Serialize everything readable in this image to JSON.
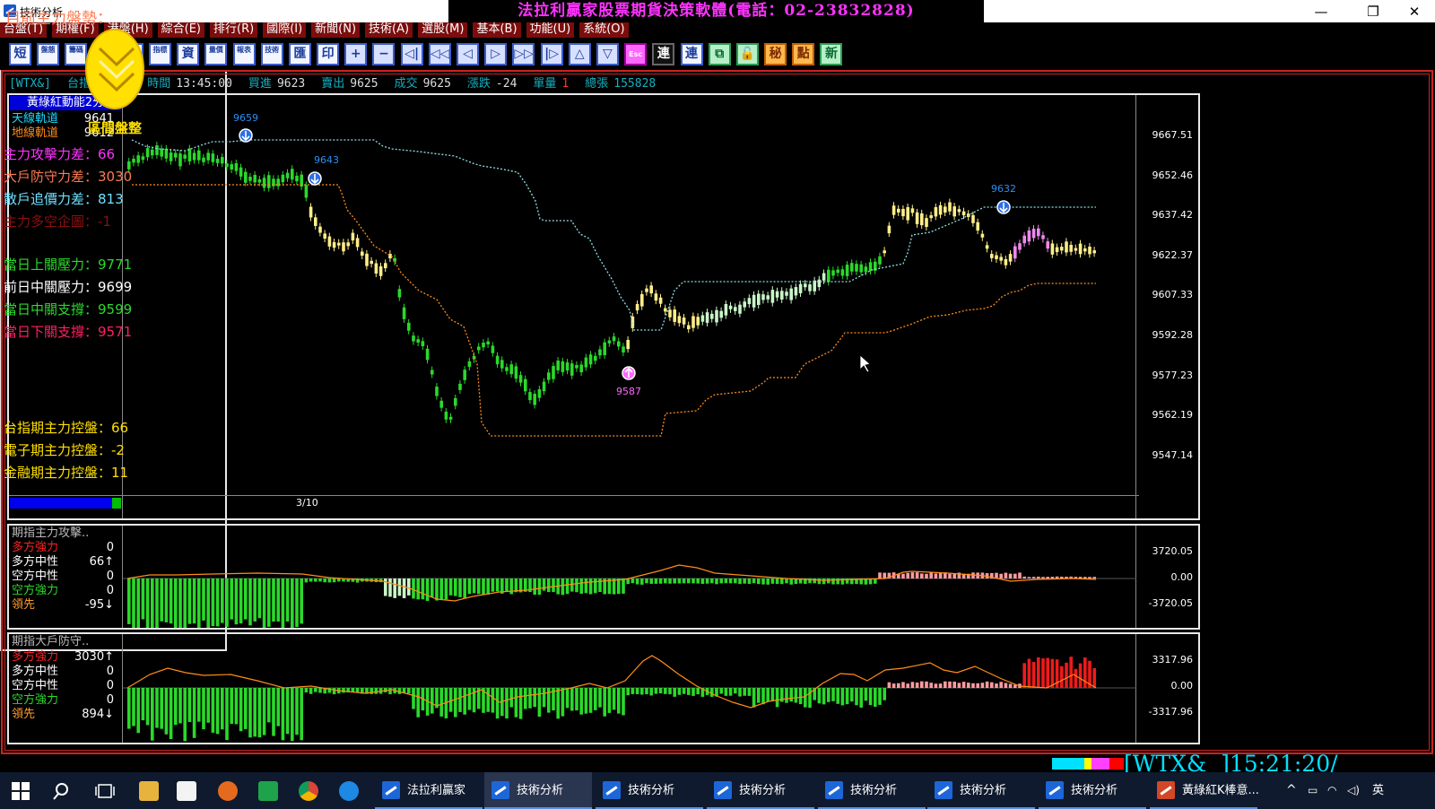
{
  "window": {
    "title": "技術分析",
    "banner": "法拉利贏家股票期貨決策軟體(電話：02-23832828)",
    "controls": [
      "—",
      "❐",
      "✕"
    ]
  },
  "menu": [
    "台盤(T)",
    "期權(F)",
    "港盤(H)",
    "綜合(E)",
    "排行(R)",
    "國際(I)",
    "新聞(N)",
    "技術(A)",
    "選股(M)",
    "基本(B)",
    "功能(U)",
    "系統(O)"
  ],
  "toolbar": [
    "短",
    "盤態",
    "籌碼",
    "自",
    "商",
    "指標",
    "資",
    "量價",
    "報表",
    "技術",
    "匯",
    "印",
    "+",
    "−",
    "◁|",
    "◁◁",
    "◁",
    "▷",
    "▷▷",
    "|▷",
    "△",
    "▽",
    "Esc",
    "連",
    "連",
    "⧉",
    "🔓",
    "秘",
    "點",
    "新"
  ],
  "infobar": {
    "symbol": "[WTX&]",
    "name": "台指期&(2分)",
    "time_label": "時間",
    "time": "13:45:00",
    "buy_label": "買進",
    "buy": "9623",
    "sell_label": "賣出",
    "sell": "9625",
    "deal_label": "成交",
    "deal": "9625",
    "chg_label": "漲跌",
    "chg": "-24",
    "vol_label": "單量",
    "vol": "1",
    "total_label": "總張",
    "total": "155828"
  },
  "main": {
    "title": "黃綠紅動能2分",
    "legend": [
      {
        "label": "天線軌道",
        "value": "9641",
        "color": "#19d9ff"
      },
      {
        "label": "地線軌道",
        "value": "9612",
        "color": "#ff8c1a"
      }
    ],
    "yticks": [
      "9667.51",
      "9652.46",
      "9637.42",
      "9622.37",
      "9607.33",
      "9592.28",
      "9577.23",
      "9562.19",
      "9547.14"
    ],
    "date": "3/10",
    "annotations": [
      "9659",
      "9643",
      "9632",
      "9587"
    ]
  },
  "mid": {
    "title": "期指主力攻擊..",
    "rows": [
      {
        "label": "多方強力",
        "value": "0",
        "color": "#ff2020"
      },
      {
        "label": "多方中性",
        "value": "66↑",
        "color": "#ffffff"
      },
      {
        "label": "空方中性",
        "value": "0",
        "color": "#ffffff"
      },
      {
        "label": "空方強力",
        "value": "0",
        "color": "#2ad92a"
      },
      {
        "label": "領先",
        "value": "-95↓",
        "color": "#ff9a2a"
      }
    ],
    "yticks": [
      "3720.05",
      "0.00",
      "-3720.05"
    ]
  },
  "bot": {
    "title": "期指大戶防守..",
    "rows": [
      {
        "label": "多方強力",
        "value": "3030↑",
        "color": "#ff2020"
      },
      {
        "label": "多方中性",
        "value": "0",
        "color": "#ffffff"
      },
      {
        "label": "空方中性",
        "value": "0",
        "color": "#ffffff"
      },
      {
        "label": "空方強力",
        "value": "0",
        "color": "#2ad92a"
      },
      {
        "label": "領先",
        "value": "894↓",
        "color": "#ff9a2a"
      }
    ],
    "yticks": [
      "3317.96",
      "0.00",
      "-3317.96"
    ]
  },
  "right": {
    "title": "目前主力盤勢：",
    "coin_label": "區間盤整",
    "rows": [
      {
        "text": "主力攻擊力差：66",
        "color": "#ff33ff"
      },
      {
        "text": "大戶防守力差：3030",
        "color": "#ff7a50"
      },
      {
        "text": "散戶追價力差：813",
        "color": "#6fe0ff"
      },
      {
        "text": "主力多空企圖：-1",
        "color": "#8a1010"
      },
      {
        "text": "當日上關壓力：9771",
        "color": "#2ad92a"
      },
      {
        "text": "前日中關壓力：9699",
        "color": "#ffffff"
      },
      {
        "text": "當日中關支撐：9599",
        "color": "#2ad92a"
      },
      {
        "text": "當日下關支撐：9571",
        "color": "#ff2060"
      },
      {
        "text": "台指期主力控盤：66",
        "color": "#ffe000"
      },
      {
        "text": "電子期主力控盤：-2",
        "color": "#ffe000"
      },
      {
        "text": "金融期主力控盤：11",
        "color": "#ffe000"
      }
    ]
  },
  "status": {
    "text": "[WTX&  ]15:21:20/"
  },
  "taskbar": {
    "items": [
      "法拉利贏家",
      "技術分析",
      "技術分析",
      "技術分析",
      "技術分析",
      "技術分析",
      "技術分析",
      "黃綠紅K棒意..."
    ],
    "ime": "英"
  },
  "chart_data": {
    "type": "candlestick",
    "ylim": [
      9547.14,
      9667.51
    ],
    "yticks": [
      9667.51,
      9652.46,
      9637.42,
      9622.37,
      9607.33,
      9592.28,
      9577.23,
      9562.19,
      9547.14
    ],
    "upper_band_last": 9641,
    "lower_band_last": 9612,
    "markers": [
      {
        "label": "9659",
        "type": "sell"
      },
      {
        "label": "9643",
        "type": "sell"
      },
      {
        "label": "9632",
        "type": "sell"
      },
      {
        "label": "9587",
        "type": "buy"
      }
    ]
  }
}
